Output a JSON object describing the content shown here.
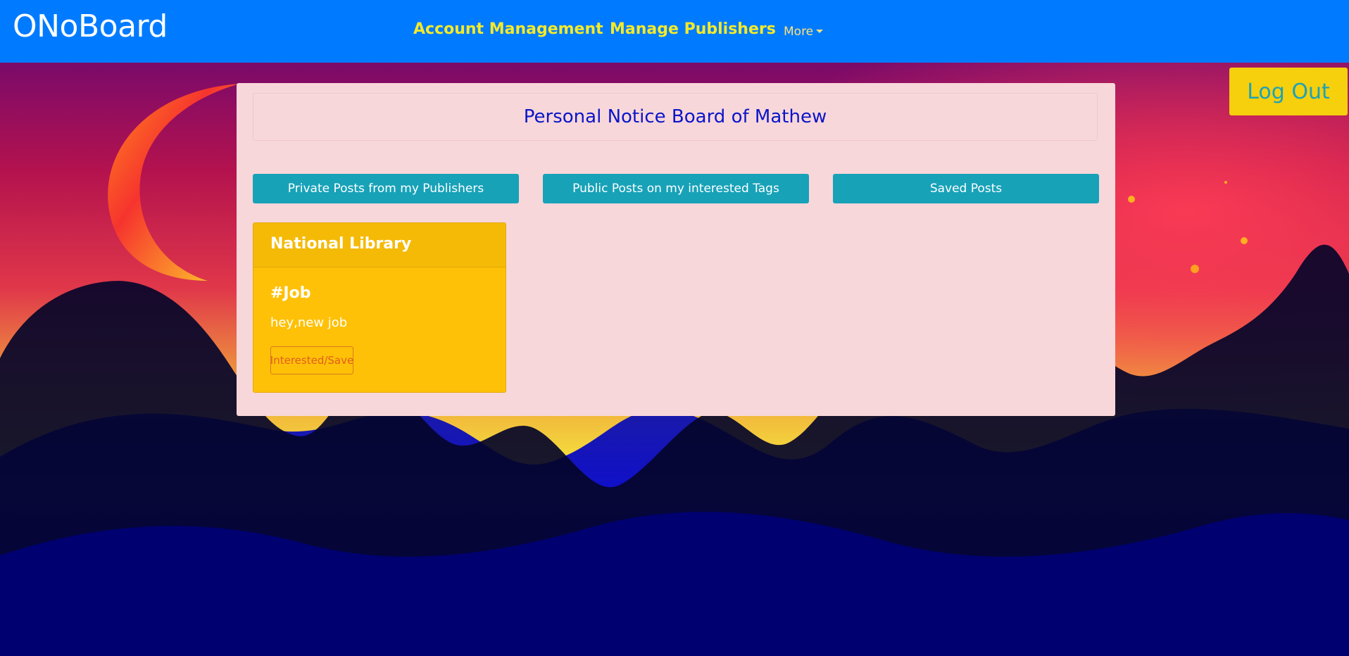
{
  "navbar": {
    "brand": "ONoBoard",
    "links": [
      {
        "label": "Account Management"
      },
      {
        "label": "Manage Publishers"
      }
    ],
    "more_label": "More"
  },
  "logout_label": "Log Out",
  "board": {
    "title": "Personal Notice Board of Mathew",
    "tabs": [
      {
        "label": "Private Posts from my Publishers"
      },
      {
        "label": "Public Posts on my interested Tags"
      },
      {
        "label": "Saved Posts"
      }
    ]
  },
  "posts": [
    {
      "publisher": "National Library",
      "tag": "#Job",
      "text": "hey,new job",
      "action_label": "Interested/Save"
    }
  ],
  "colors": {
    "navbar": "#007bff",
    "nav_link": "#f4ea2a",
    "panel": "#f8d7da",
    "tab_button": "#17a2b8",
    "card": "#ffc107",
    "logout": "#f6cf0d",
    "title_text": "#0a16c8"
  },
  "icons": {
    "more_dropdown": "caret-down-icon"
  }
}
